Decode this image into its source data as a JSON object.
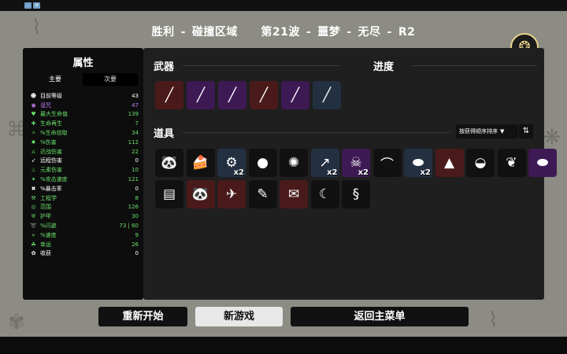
{
  "header": {
    "result": "胜利",
    "map": "碰撞区域",
    "wave": "第21波",
    "difficulty": "噩梦",
    "mode": "无尽",
    "run": "R2",
    "separator": "-"
  },
  "stats": {
    "title": "属性",
    "tab_primary": "主要",
    "tab_secondary": "次要",
    "rows": [
      {
        "icon": "level-icon",
        "glyph": "☻",
        "label": "目前等级",
        "value": "43",
        "color": "white"
      },
      {
        "icon": "curse-icon",
        "glyph": "◉",
        "label": "诅咒",
        "value": "47",
        "color": "purple"
      },
      {
        "icon": "heart-icon",
        "glyph": "♥",
        "label": "最大生命值",
        "value": "139",
        "color": "green"
      },
      {
        "icon": "regen-icon",
        "glyph": "✚",
        "label": "生命再生",
        "value": "7",
        "color": "green"
      },
      {
        "icon": "lifesteal-icon",
        "glyph": "✧",
        "label": "%生命窃取",
        "value": "34",
        "color": "green"
      },
      {
        "icon": "damage-icon",
        "glyph": "✹",
        "label": "%伤害",
        "value": "112",
        "color": "green"
      },
      {
        "icon": "melee-icon",
        "glyph": "⚔",
        "label": "近战伤害",
        "value": "22",
        "color": "green"
      },
      {
        "icon": "ranged-icon",
        "glyph": "➶",
        "label": "远程伤害",
        "value": "0",
        "color": "white"
      },
      {
        "icon": "elemental-icon",
        "glyph": "♨",
        "label": "元素伤害",
        "value": "10",
        "color": "green"
      },
      {
        "icon": "attack-speed-icon",
        "glyph": "✦",
        "label": "%攻击速度",
        "value": "121",
        "color": "green"
      },
      {
        "icon": "crit-icon",
        "glyph": "✖",
        "label": "%暴击率",
        "value": "0",
        "color": "white"
      },
      {
        "icon": "engineering-icon",
        "glyph": "⚒",
        "label": "工程学",
        "value": "8",
        "color": "green"
      },
      {
        "icon": "range-icon",
        "glyph": "◎",
        "label": "范围",
        "value": "126",
        "color": "green"
      },
      {
        "icon": "armor-icon",
        "glyph": "⛨",
        "label": "护甲",
        "value": "30",
        "color": "green"
      },
      {
        "icon": "dodge-icon",
        "glyph": "➰",
        "label": "%闪避",
        "value": "73 | 60",
        "color": "green"
      },
      {
        "icon": "speed-icon",
        "glyph": "»",
        "label": "%速度",
        "value": "9",
        "color": "green"
      },
      {
        "icon": "luck-icon",
        "glyph": "☘",
        "label": "幸运",
        "value": "26",
        "color": "green"
      },
      {
        "icon": "harvest-icon",
        "glyph": "✿",
        "label": "收获",
        "value": "0",
        "color": "white"
      }
    ]
  },
  "weapons": {
    "title": "武器",
    "progress_title": "进度",
    "items": [
      {
        "name": "stick-weapon-icon",
        "tier": "red",
        "glyph": "╱"
      },
      {
        "name": "cursed-stick-weapon-icon",
        "tier": "purple",
        "glyph": "╱"
      },
      {
        "name": "cursed-stick-weapon-icon",
        "tier": "purple",
        "glyph": "╱"
      },
      {
        "name": "stick-weapon-icon",
        "tier": "red",
        "glyph": "╱"
      },
      {
        "name": "cursed-stick-weapon-icon",
        "tier": "purple",
        "glyph": "╱"
      },
      {
        "name": "stick-weapon-icon",
        "tier": "blue",
        "glyph": "╱"
      }
    ]
  },
  "items": {
    "title": "道具",
    "sort_label": "按获得顺序排序",
    "sort_arrow": "▼",
    "sort_toggle": "⇅",
    "list": [
      {
        "name": "panda-item-icon",
        "tier": "dark",
        "glyph": "🐼",
        "qty": ""
      },
      {
        "name": "cake-item-icon",
        "tier": "dark",
        "glyph": "🍰",
        "qty": ""
      },
      {
        "name": "robot-item-icon",
        "tier": "blue",
        "glyph": "⚙",
        "qty": "x2"
      },
      {
        "name": "egg-item-icon",
        "tier": "dark",
        "glyph": "●",
        "qty": ""
      },
      {
        "name": "bug-item-icon",
        "tier": "dark",
        "glyph": "✺",
        "qty": ""
      },
      {
        "name": "fishing-rod-item-icon",
        "tier": "blue",
        "glyph": "↗",
        "qty": "x2"
      },
      {
        "name": "zombie-item-icon",
        "tier": "purple",
        "glyph": "☠",
        "qty": "x2"
      },
      {
        "name": "banana-item-icon",
        "tier": "dark",
        "glyph": "⌒",
        "qty": ""
      },
      {
        "name": "boots-item-icon",
        "tier": "blue",
        "glyph": "⬬",
        "qty": "x2"
      },
      {
        "name": "gnome-item-icon",
        "tier": "red",
        "glyph": "▲",
        "qty": ""
      },
      {
        "name": "ufo-item-icon",
        "tier": "dark",
        "glyph": "◒",
        "qty": ""
      },
      {
        "name": "sprout-item-icon",
        "tier": "dark",
        "glyph": "❦",
        "qty": ""
      },
      {
        "name": "cursed-boots-item-icon",
        "tier": "purple",
        "glyph": "⬬",
        "qty": ""
      },
      {
        "name": "ladder-item-icon",
        "tier": "dark",
        "glyph": "▤",
        "qty": ""
      },
      {
        "name": "panda-baby-item-icon",
        "tier": "red",
        "glyph": "🐼",
        "qty": ""
      },
      {
        "name": "shrimp-item-icon",
        "tier": "red",
        "glyph": "✈",
        "qty": ""
      },
      {
        "name": "pencil-item-icon",
        "tier": "dark",
        "glyph": "✎",
        "qty": ""
      },
      {
        "name": "scroll-item-icon",
        "tier": "red",
        "glyph": "✉",
        "qty": ""
      },
      {
        "name": "scarf-item-icon",
        "tier": "dark",
        "glyph": "☾",
        "qty": ""
      },
      {
        "name": "snake-item-icon",
        "tier": "dark",
        "glyph": "§",
        "qty": ""
      }
    ]
  },
  "buttons": {
    "restart": "重新开始",
    "new_game": "新游戏",
    "main_menu": "返回主菜单"
  }
}
